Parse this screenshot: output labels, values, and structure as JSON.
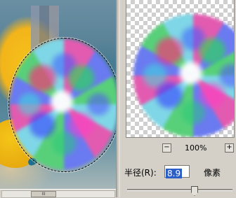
{
  "dialog": {
    "zoom": {
      "minus_label": "−",
      "plus_label": "+",
      "value": "100%"
    },
    "radius": {
      "label": "半径(R):",
      "value": "8.9",
      "unit": "像素"
    },
    "slider_position": 0.63
  },
  "canvas": {
    "scrollbar_grip": "III"
  }
}
